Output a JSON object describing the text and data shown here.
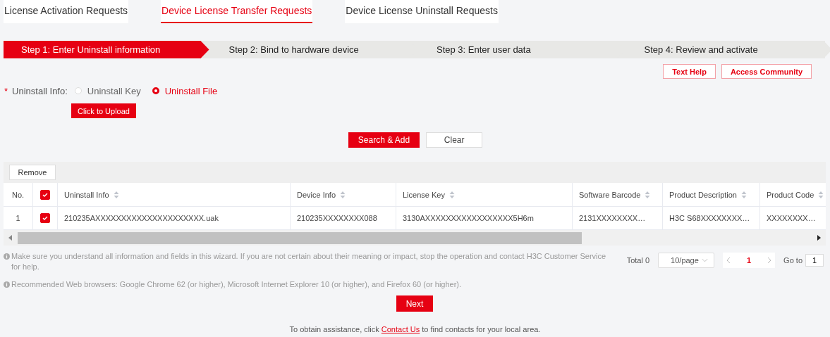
{
  "tabs": [
    {
      "label": "License Activation Requests",
      "selected": false
    },
    {
      "label": "Device License Transfer Requests",
      "selected": true
    },
    {
      "label": "Device License Uninstall Requests",
      "selected": false
    }
  ],
  "steps": [
    {
      "label": "Step 1: Enter Uninstall information",
      "selected": true
    },
    {
      "label": "Step 2: Bind to hardware device",
      "selected": false
    },
    {
      "label": "Step 3: Enter user data",
      "selected": false
    },
    {
      "label": "Step 4: Review and activate",
      "selected": false
    }
  ],
  "help_buttons": [
    "Text Help",
    "Access Community"
  ],
  "uninstall_info": {
    "required_mark": "*",
    "label": "Uninstall Info:",
    "options": [
      {
        "label": "Uninstall Key",
        "selected": false
      },
      {
        "label": "Uninstall File",
        "selected": true
      }
    ],
    "upload_button": "Click to Upload"
  },
  "actions": [
    "Search & Add",
    "Clear"
  ],
  "table": {
    "toolbar_button": "Remove",
    "select_all_checked": true,
    "columns": [
      {
        "label": "No.",
        "sortable": false
      },
      {
        "label": "Uninstall Info",
        "sortable": true
      },
      {
        "label": "Device Info",
        "sortable": true
      },
      {
        "label": "License Key",
        "sortable": true
      },
      {
        "label": "Software Barcode",
        "sortable": true
      },
      {
        "label": "Product Description",
        "sortable": true
      },
      {
        "label": "Product Code",
        "sortable": true
      }
    ],
    "rows": [
      {
        "checked": true,
        "cells": [
          "1",
          "210235AXXXXXXXXXXXXXXXXXXXXX.uak",
          "210235XXXXXXXX088",
          "3130AXXXXXXXXXXXXXXXXX5H6m",
          "2131XXXXXXXX…",
          "H3C S68XXXXXXXX…",
          "XXXXXXXX…"
        ]
      }
    ]
  },
  "notes": [
    "Make sure you understand all information and fields in this wizard. If you are not certain about their meaning or impact, stop the operation and contact H3C Customer Service for help.",
    "Recommended Web browsers: Google Chrome 62 (or higher), Microsoft Internet Explorer 10 (or higher), and Firefox 60 (or higher)."
  ],
  "pagination": {
    "total": "Total 0",
    "page_size": "10/page",
    "pages": [
      {
        "label": "1",
        "selected": true
      }
    ],
    "goto_label": "Go to",
    "goto_value": "1"
  },
  "next_button": "Next",
  "footer": {
    "before": "To obtain assistance, click",
    "link": "Contact Us",
    "after": "to find contacts for your local area."
  }
}
